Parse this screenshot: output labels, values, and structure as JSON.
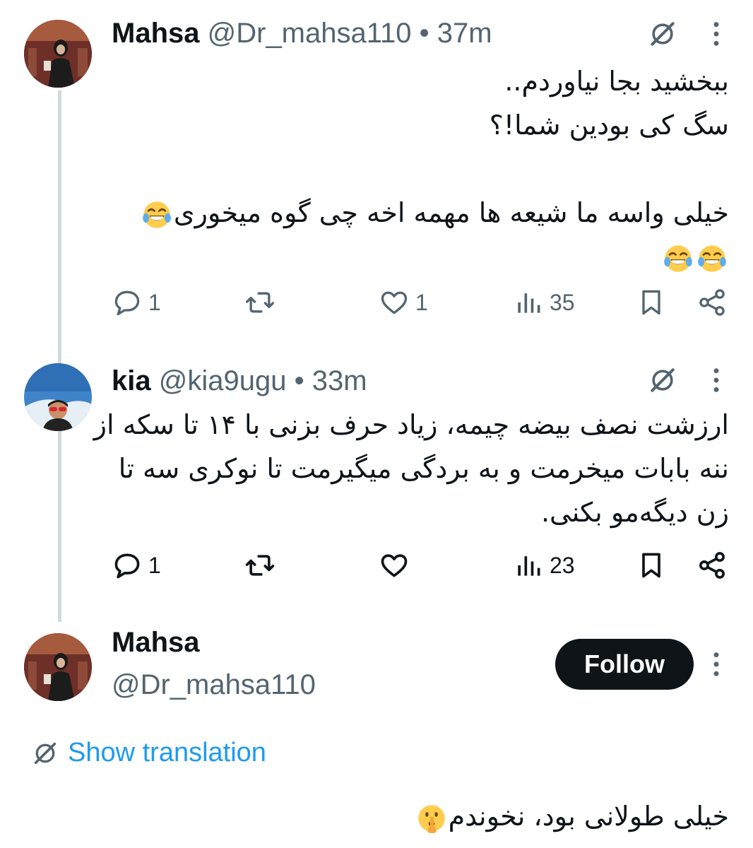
{
  "tweets": [
    {
      "author_name": "Mahsa",
      "handle": "@Dr_mahsa110",
      "separator": "•",
      "time": "37m",
      "text_lines": [
        "ببخشید بجا نیاوردم..",
        "سگ کی بودین شما!؟",
        "",
        "خیلی واسه ما شیعه ها مهمه اخه چی گوه میخوری",
        ""
      ],
      "actions": {
        "replies": "1",
        "retweets": "",
        "likes": "1",
        "views": "35"
      }
    },
    {
      "author_name": "kia",
      "handle": "@kia9ugu",
      "separator": "•",
      "time": "33m",
      "text_lines": [
        "ارزشت نصف بیضه چیمه، زیاد حرف بزنی با ۱۴ تا سکه از",
        "ننه بابات میخرمت و به بردگی میگیرمت تا نوکری سه تا",
        "زن دیگه‌مو بکنی."
      ],
      "actions": {
        "replies": "1",
        "retweets": "",
        "likes": "",
        "views": "23"
      }
    }
  ],
  "main_tweet": {
    "author_name": "Mahsa",
    "handle": "@Dr_mahsa110",
    "follow_label": "Follow",
    "translate_label": "Show translation",
    "text": "خیلی طولانی بود، نخوندم"
  },
  "icons": {
    "grok": "grok-slash-icon",
    "more": "more-vertical-icon",
    "reply": "reply-bubble-icon",
    "retweet": "retweet-icon",
    "like": "heart-icon",
    "views": "views-bars-icon",
    "bookmark": "bookmark-icon",
    "share": "share-icon",
    "laugh": "tears-of-joy-emoji",
    "shush": "shushing-face-emoji"
  },
  "colors": {
    "text": "#0f1419",
    "secondary": "#536471",
    "link": "#1d9bf0",
    "thread_line": "#cfd9de",
    "follow_bg": "#0f1419"
  }
}
